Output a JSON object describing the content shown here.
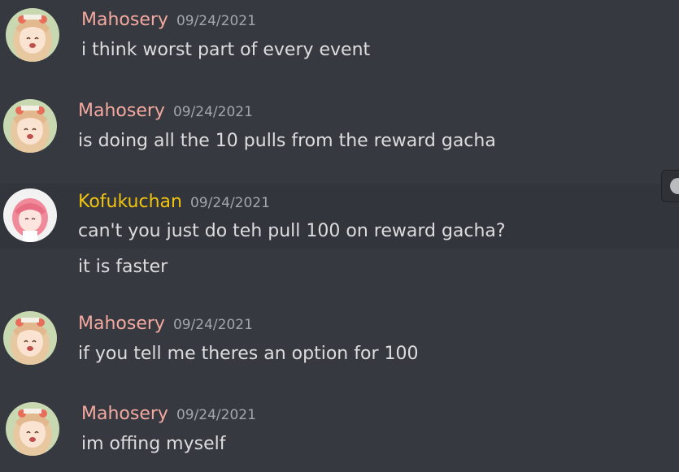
{
  "colors": {
    "background": "#36393f",
    "hover_background": "#32353b",
    "mahosery_name": "#f4a9a0",
    "kofukuchan_name": "#f1c40f",
    "message_text": "#dcddde",
    "timestamp": "#a3a6aa"
  },
  "messages": [
    {
      "author": "Mahosery",
      "timestamp": "09/24/2021",
      "text": "i think worst part of every event"
    },
    {
      "author": "Mahosery",
      "timestamp": "09/24/2021",
      "text": "is doing all the 10 pulls from the reward gacha"
    },
    {
      "author": "Kofukuchan",
      "timestamp": "09/24/2021",
      "text": "can't you just do teh pull 100 on reward gacha?",
      "followup": "it is faster"
    },
    {
      "author": "Mahosery",
      "timestamp": "09/24/2021",
      "text": "if you tell me theres an option for 100"
    },
    {
      "author": "Mahosery",
      "timestamp": "09/24/2021",
      "text": "im offing myself"
    }
  ],
  "icons": {
    "message_actions": "emoji-reaction-icon"
  }
}
